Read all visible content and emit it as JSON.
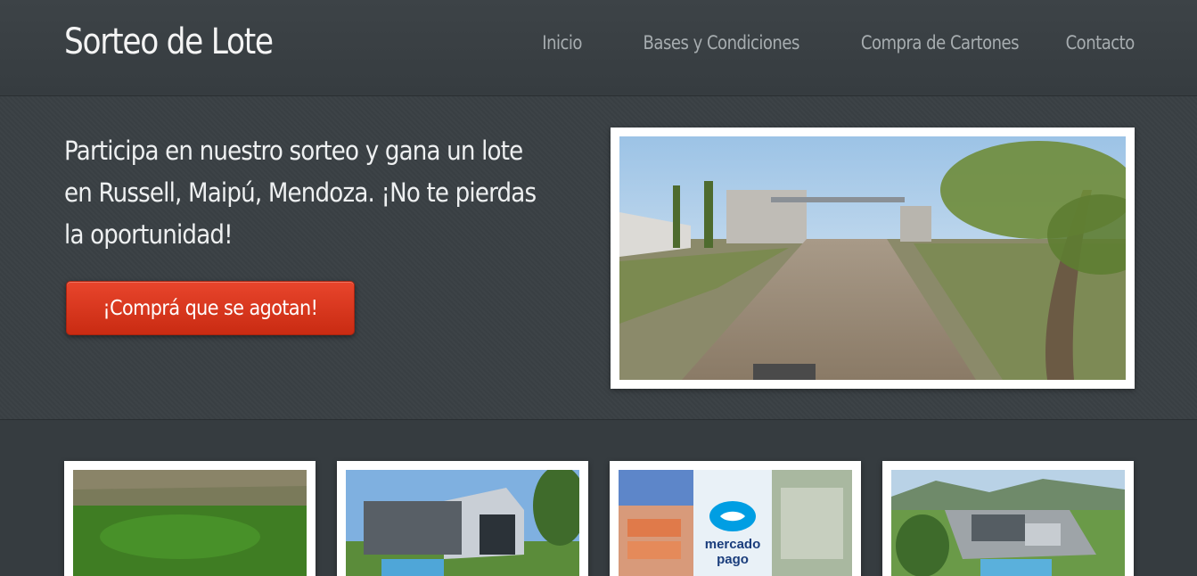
{
  "brand": {
    "title": "Sorteo de Lote"
  },
  "nav": {
    "items": [
      {
        "label": "Inicio"
      },
      {
        "label": "Bases y Condiciones"
      },
      {
        "label": "Compra de Cartones"
      },
      {
        "label": "Contacto"
      }
    ]
  },
  "hero": {
    "headline": "Participa en nuestro sorteo y gana un lote en Russell, Maipú, Mendoza. ¡No te pierdas la oportunidad!",
    "cta_label": "¡Comprá que se agotan!",
    "cta_color": "#d6361c"
  },
  "gallery": {
    "images": [
      {
        "name": "photo-grass-lot"
      },
      {
        "name": "photo-house-render"
      },
      {
        "name": "photo-mercado-pago"
      },
      {
        "name": "photo-house-aerial"
      }
    ],
    "mercado_pago_text": "mercado pago"
  }
}
